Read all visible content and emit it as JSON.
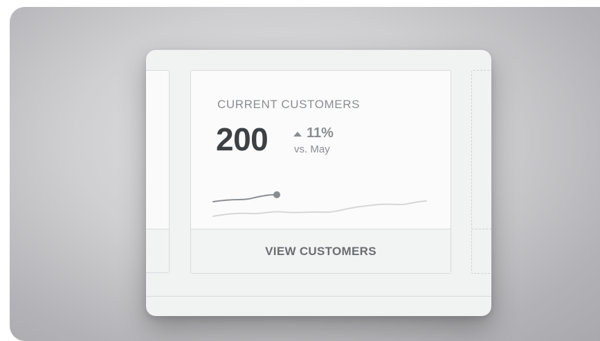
{
  "metric_card": {
    "label": "CURRENT CUSTOMERS",
    "value": "200",
    "delta": "11%",
    "delta_direction": "up",
    "comparison": "vs. May",
    "action_label": "VIEW CUSTOMERS"
  },
  "colors": {
    "primary_text": "#3e4144",
    "muted_text": "#8a8d90",
    "current_line": "#8a8d90",
    "comparison_line": "#d6d7d8"
  },
  "icons": {
    "delta": "triangle-up-icon"
  }
}
